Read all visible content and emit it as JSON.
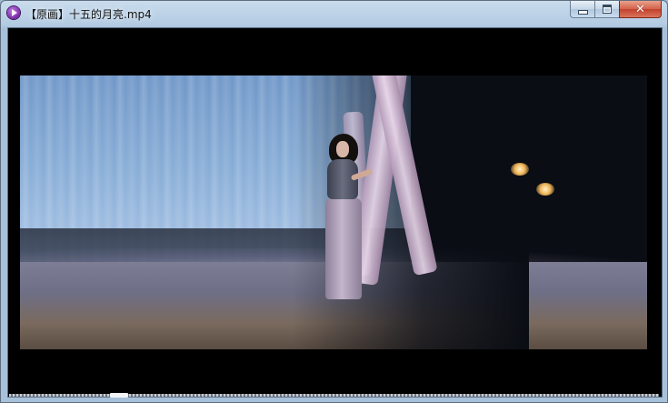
{
  "window": {
    "title": "【原画】十五的月亮.mp4",
    "app_icon": "media-player-play-icon",
    "buttons": {
      "minimize": "minimize-icon",
      "maximize": "maximize-icon",
      "close": "close-icon"
    },
    "close_glyph": "✕"
  },
  "player": {
    "progress": 0.16
  },
  "colors": {
    "client_background": "#000000",
    "close_button": "#c2412a",
    "frame": "#a8c1da"
  }
}
